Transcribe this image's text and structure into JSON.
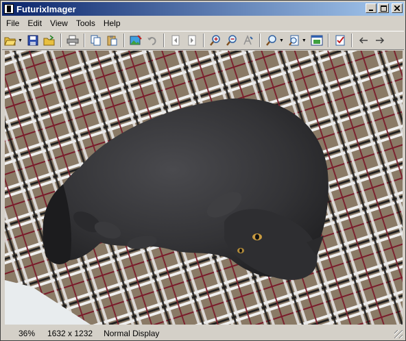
{
  "window": {
    "title": "FuturixImager"
  },
  "menu": [
    "File",
    "Edit",
    "View",
    "Tools",
    "Help"
  ],
  "toolbar": {
    "buttons": [
      "open-folder-icon",
      "save-icon",
      "open-file-icon",
      "print-icon",
      "copy-icon",
      "paste-icon",
      "image-properties-icon",
      "undo-icon",
      "previous-file-icon",
      "next-file-icon",
      "zoom-in-icon",
      "zoom-out-icon",
      "zoom-reset-icon",
      "zoom-dropdown-icon",
      "fit-to-window-icon",
      "fullscreen-icon",
      "task-icon",
      "back-arrow-icon",
      "forward-arrow-icon"
    ]
  },
  "image": {
    "subject": "cat-photo"
  },
  "status": {
    "zoom": "36%",
    "dimensions": "1632 x 1232",
    "mode": "Normal Display"
  },
  "colors": {
    "title_start": "#0a246a",
    "title_end": "#a6caf0",
    "chrome": "#d4d0c8"
  }
}
